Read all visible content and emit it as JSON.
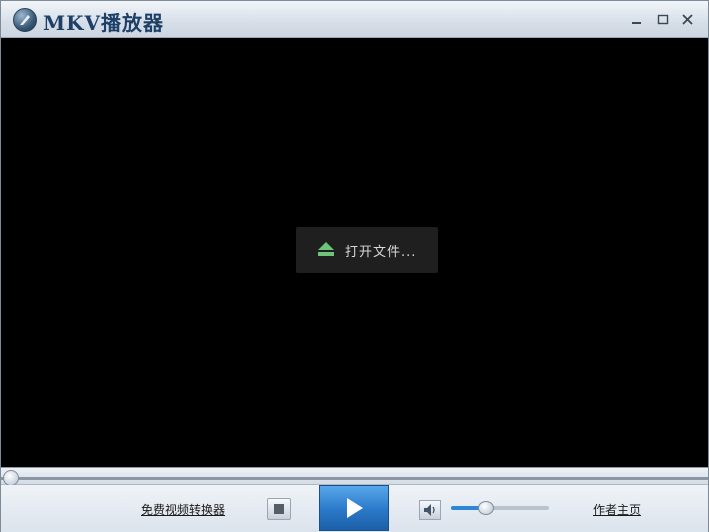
{
  "window": {
    "title": "MKV播放器",
    "minimize_label": "minimize",
    "maximize_label": "maximize",
    "close_label": "close"
  },
  "video": {
    "open_file_label": "打开文件..."
  },
  "seekbar": {
    "progress": 0.0
  },
  "controls": {
    "converter_link": "免费视频转换器",
    "author_link": "作者主页",
    "volume": 0.35
  },
  "colors": {
    "accent": "#2e86d6",
    "play_button": "#2a78c8",
    "eject_icon": "#6ec37a"
  },
  "icons": {
    "logo": "mkv-logo-icon",
    "eject": "eject-icon",
    "stop": "stop-icon",
    "play": "play-icon",
    "volume": "speaker-icon"
  }
}
